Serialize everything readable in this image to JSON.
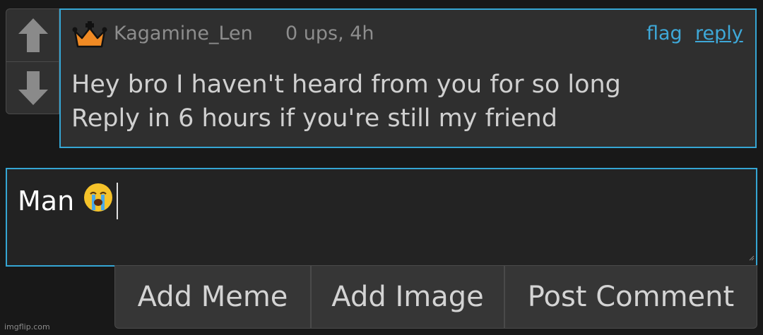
{
  "comment": {
    "username": "Kagamine_Len",
    "meta": "0 ups, 4h",
    "flag_label": "flag",
    "reply_label": "reply",
    "lines": [
      "Hey bro I haven't heard from you for so long",
      "Reply in 6 hours if you're still my friend"
    ]
  },
  "vote": {
    "up_icon": "arrow-up-icon",
    "down_icon": "arrow-down-icon"
  },
  "input": {
    "value": "Man",
    "emoji": "😭"
  },
  "buttons": {
    "add_meme": "Add Meme",
    "add_image": "Add Image",
    "post_comment": "Post Comment"
  },
  "watermark": "imgflip.com",
  "colors": {
    "accent": "#35a6d4",
    "link": "#3ea8d8",
    "crown": "#f08a24",
    "background": "#181818"
  }
}
